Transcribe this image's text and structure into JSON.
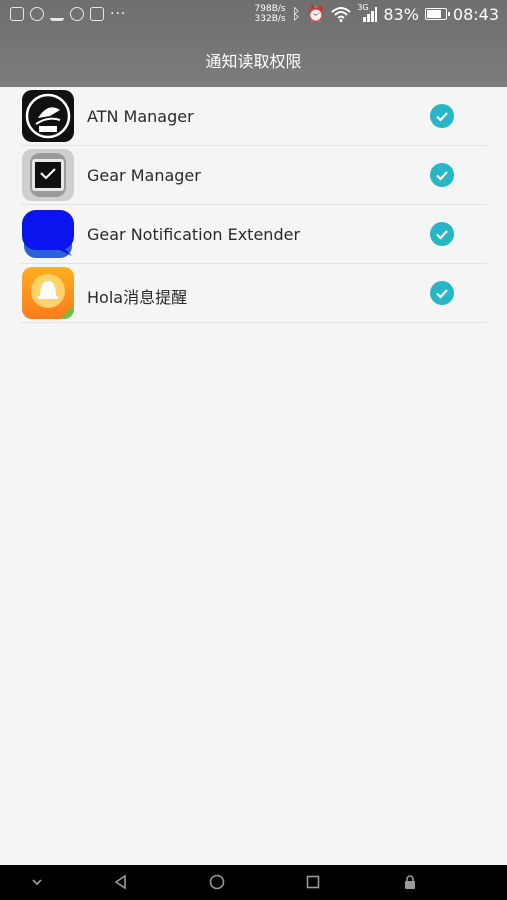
{
  "status": {
    "net_down": "798B/s",
    "net_up": "332B/s",
    "signal_type": "3G",
    "battery": "83%",
    "battery_level": 0.83,
    "time": "08:43"
  },
  "header": {
    "title": "通知读取权限"
  },
  "apps": [
    {
      "name": "ATN Manager",
      "checked": true,
      "icon": "atn-manager-icon"
    },
    {
      "name": "Gear Manager",
      "checked": true,
      "icon": "gear-manager-icon"
    },
    {
      "name": "Gear Notification Extender",
      "checked": true,
      "icon": "gear-notification-extender-icon"
    },
    {
      "name": "Hola消息提醒",
      "checked": true,
      "icon": "hola-icon"
    }
  ],
  "colors": {
    "header": "#777777",
    "accent": "#26b6c6",
    "nav": "#000000"
  }
}
